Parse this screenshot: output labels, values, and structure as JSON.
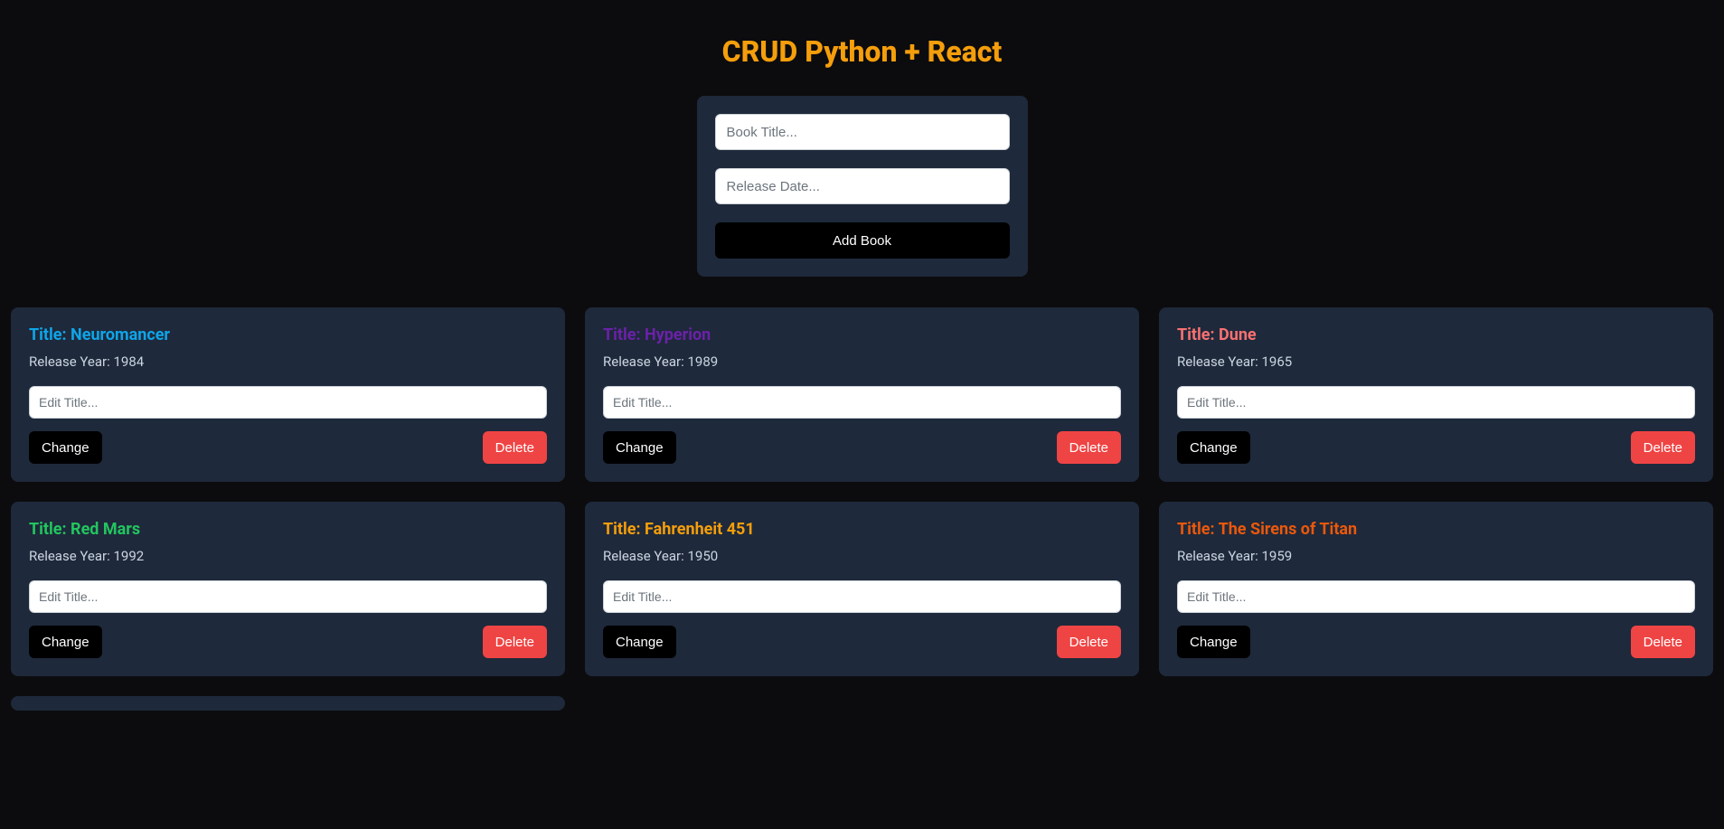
{
  "header": {
    "title": "CRUD Python + React"
  },
  "form": {
    "title_placeholder": "Book Title...",
    "year_placeholder": "Release Date...",
    "add_label": "Add Book"
  },
  "card_strings": {
    "edit_placeholder": "Edit Title...",
    "change_label": "Change",
    "delete_label": "Delete",
    "title_prefix": "Title: ",
    "year_prefix": "Release Year: "
  },
  "books": [
    {
      "title": "Neuromancer",
      "year": 1984,
      "color_class": "c-blue"
    },
    {
      "title": "Hyperion",
      "year": 1989,
      "color_class": "c-purple-dark"
    },
    {
      "title": "Dune",
      "year": 1965,
      "color_class": "c-salmon"
    },
    {
      "title": "Red Mars",
      "year": 1992,
      "color_class": "c-green"
    },
    {
      "title": "Fahrenheit 451",
      "year": 1950,
      "color_class": "c-amber"
    },
    {
      "title": "The Sirens of Titan",
      "year": 1959,
      "color_class": "c-orange"
    }
  ]
}
